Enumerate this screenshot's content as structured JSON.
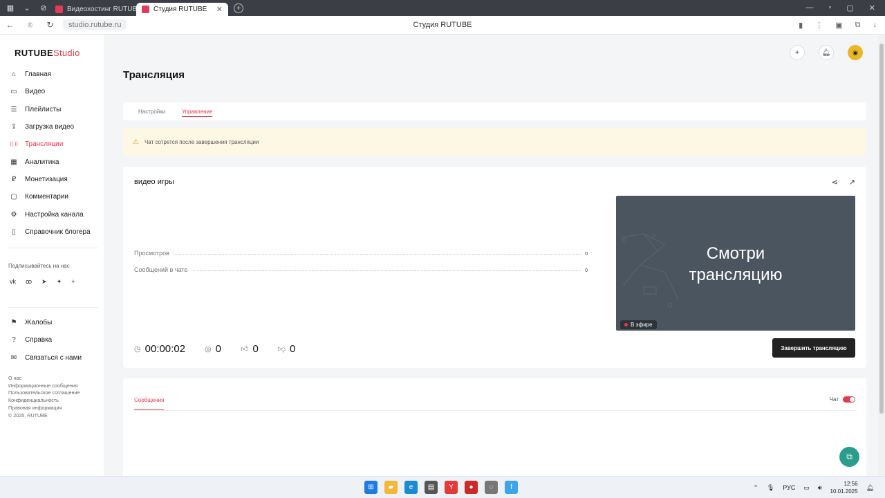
{
  "browser": {
    "tabs": [
      {
        "label": "Видеохостинг RUTUBE. С",
        "active": false
      },
      {
        "label": "Студия RUTUBE",
        "active": true
      }
    ],
    "url": "studio.rutube.ru",
    "page_title": "Студия RUTUBE"
  },
  "logo": {
    "main": "RUTUBE",
    "suffix": "Studio"
  },
  "nav": [
    {
      "label": "Главная",
      "icon": "home-icon",
      "glyph": "⌂"
    },
    {
      "label": "Видео",
      "icon": "video-icon",
      "glyph": "▭"
    },
    {
      "label": "Плейлисты",
      "icon": "playlist-icon",
      "glyph": "☰"
    },
    {
      "label": "Загрузка видео",
      "icon": "upload-icon",
      "glyph": "⇪"
    },
    {
      "label": "Трансляции",
      "icon": "broadcast-icon",
      "glyph": "((·))",
      "active": true
    },
    {
      "label": "Аналитика",
      "icon": "analytics-icon",
      "glyph": "▦"
    },
    {
      "label": "Монетизация",
      "icon": "monetization-icon",
      "glyph": "₽"
    },
    {
      "label": "Комментарии",
      "icon": "comments-icon",
      "glyph": "▢"
    },
    {
      "label": "Настройка канала",
      "icon": "gear-icon",
      "glyph": "⚙"
    },
    {
      "label": "Справочник блогера",
      "icon": "book-icon",
      "glyph": "▯"
    }
  ],
  "follow_label": "Подписывайтесь на нас",
  "socials": [
    "vk",
    "ok",
    "tg",
    "dzen",
    "+"
  ],
  "nav2": [
    {
      "label": "Жалобы",
      "icon": "flag-icon",
      "glyph": "⚑"
    },
    {
      "label": "Справка",
      "icon": "help-icon",
      "glyph": "?"
    },
    {
      "label": "Связаться с нами",
      "icon": "mail-icon",
      "glyph": "✉"
    }
  ],
  "footer": [
    "О нас",
    "Информационные сообщения",
    "Пользовательское соглашение",
    "Конфиденциальность",
    "Правовая информация",
    "© 2025, RUTUBE"
  ],
  "page": {
    "title": "Трансляция",
    "tabs": [
      "Настройки",
      "Управление"
    ],
    "warning": "Чат сотрется после завершения трансляции"
  },
  "stream": {
    "name": "видео игры",
    "stats": [
      {
        "label": "Просмотров",
        "value": "0"
      },
      {
        "label": "Сообщений в чате",
        "value": "0"
      }
    ],
    "timer": "00:00:02",
    "viewers": "0",
    "likes": "0",
    "dislikes": "0",
    "preview_text": "Смотри трансляцию",
    "live_badge": "В эфире",
    "end_button": "Завершить трансляцию"
  },
  "chat": {
    "tab": "Сообщения",
    "toggle_label": "Чат",
    "enabled": true
  },
  "taskbar": {
    "lang": "РУС",
    "time": "12:56",
    "date": "10.01.2025"
  },
  "colors": {
    "accent": "#e63a4a",
    "support": "#2a9d8f"
  }
}
